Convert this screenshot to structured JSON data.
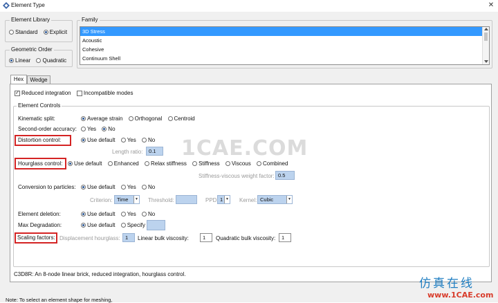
{
  "window": {
    "title": "Element Type",
    "close_glyph": "✕"
  },
  "element_library": {
    "label": "Element Library",
    "options": [
      {
        "label": "Standard",
        "selected": false
      },
      {
        "label": "Explicit",
        "selected": true
      }
    ]
  },
  "geometric_order": {
    "label": "Geometric Order",
    "options": [
      {
        "label": "Linear",
        "selected": true
      },
      {
        "label": "Quadratic",
        "selected": false
      }
    ]
  },
  "family": {
    "label": "Family",
    "items": [
      {
        "label": "3D Stress",
        "selected": true
      },
      {
        "label": "Acoustic",
        "selected": false
      },
      {
        "label": "Cohesive",
        "selected": false
      },
      {
        "label": "Continuum Shell",
        "selected": false
      }
    ]
  },
  "tabs": [
    {
      "label": "Hex",
      "active": true
    },
    {
      "label": "Wedge",
      "active": false
    }
  ],
  "checkboxes": {
    "reduced_integration": {
      "label": "Reduced integration",
      "checked": true,
      "mark": "✓"
    },
    "incompatible_modes": {
      "label": "Incompatible modes",
      "checked": false
    }
  },
  "element_controls": {
    "label": "Element Controls",
    "kinematic_split": {
      "label": "Kinematic split:",
      "options": [
        {
          "label": "Average strain",
          "selected": true
        },
        {
          "label": "Orthogonal",
          "selected": false
        },
        {
          "label": "Centroid",
          "selected": false
        }
      ]
    },
    "second_order_accuracy": {
      "label": "Second-order accuracy:",
      "options": [
        {
          "label": "Yes",
          "selected": false
        },
        {
          "label": "No",
          "selected": true
        }
      ]
    },
    "distortion_control": {
      "label": "Distortion control:",
      "options": [
        {
          "label": "Use default",
          "selected": true
        },
        {
          "label": "Yes",
          "selected": false
        },
        {
          "label": "No",
          "selected": false
        }
      ],
      "length_ratio_label": "Length ratio:",
      "length_ratio_value": "0.1"
    },
    "hourglass_control": {
      "label": "Hourglass control:",
      "options": [
        {
          "label": "Use default",
          "selected": true
        },
        {
          "label": "Enhanced",
          "selected": false
        },
        {
          "label": "Relax stiffness",
          "selected": false
        },
        {
          "label": "Stiffness",
          "selected": false
        },
        {
          "label": "Viscous",
          "selected": false
        },
        {
          "label": "Combined",
          "selected": false
        }
      ],
      "weight_factor_label": "Stiffness-viscous weight factor:",
      "weight_factor_value": "0.5"
    },
    "conversion_to_particles": {
      "label": "Conversion to particles:",
      "options": [
        {
          "label": "Use default",
          "selected": true
        },
        {
          "label": "Yes",
          "selected": false
        },
        {
          "label": "No",
          "selected": false
        }
      ],
      "criterion_label": "Criterion:",
      "criterion_value": "Time",
      "threshold_label": "Threshold:",
      "threshold_value": "",
      "ppd_label": "PPD:",
      "ppd_value": "1",
      "kernel_label": "Kernel:",
      "kernel_value": "Cubic"
    },
    "element_deletion": {
      "label": "Element deletion:",
      "options": [
        {
          "label": "Use default",
          "selected": true
        },
        {
          "label": "Yes",
          "selected": false
        },
        {
          "label": "No",
          "selected": false
        }
      ]
    },
    "max_degradation": {
      "label": "Max Degradation:",
      "options": [
        {
          "label": "Use default",
          "selected": true
        },
        {
          "label": "Specify",
          "selected": false
        }
      ],
      "value": ""
    },
    "scaling_factors": {
      "label": "Scaling factors:",
      "displacement_hourglass_label": "Displacement hourglass:",
      "displacement_hourglass_value": "1",
      "linear_bulk_label": "Linear bulk viscosity:",
      "linear_bulk_value": "1",
      "quadratic_bulk_label": "Quadratic bulk viscosity:",
      "quadratic_bulk_value": "1"
    }
  },
  "description": "C3D8R:  An 8-node linear brick, reduced integration, hourglass control.",
  "note": "Note:  To select an element shape for meshing,",
  "watermark": "1CAE.COM",
  "corner_brand": {
    "chinese": "仿真在线",
    "url": "www.1CAE.com"
  },
  "colors": {
    "highlight_box": "#d42323",
    "selection": "#3399ff",
    "field_bg": "#bcd3ee"
  }
}
